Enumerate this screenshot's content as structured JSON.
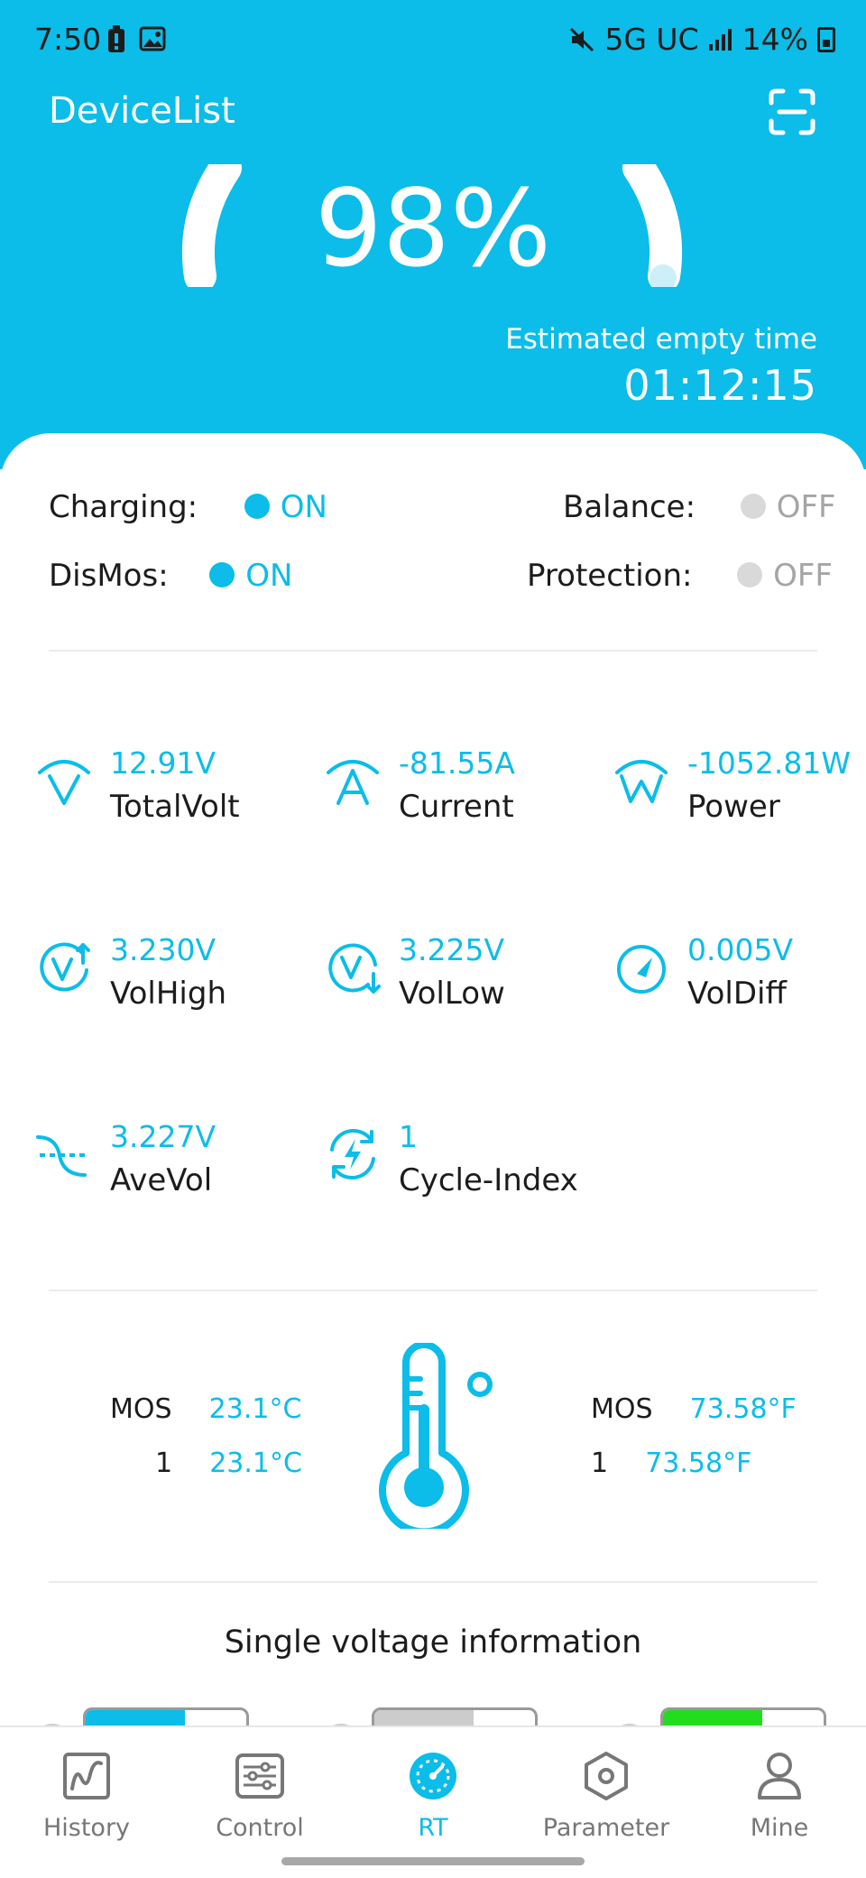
{
  "status_bar": {
    "time": "7:50",
    "network": "5G UC",
    "battery_percent": "14%"
  },
  "header": {
    "title": "DeviceList",
    "soc": "98%",
    "empty_time_label": "Estimated empty time",
    "empty_time_value": "01:12:15",
    "soc_fraction": 0.98
  },
  "states": {
    "charging": {
      "label": "Charging:",
      "value": "ON"
    },
    "dismos": {
      "label": "DisMos:",
      "value": "ON"
    },
    "balance": {
      "label": "Balance:",
      "value": "OFF"
    },
    "protection": {
      "label": "Protection:",
      "value": "OFF"
    }
  },
  "metrics": [
    {
      "value": "12.91V",
      "name": "TotalVolt",
      "icon": "volt-gauge-icon"
    },
    {
      "value": "-81.55A",
      "name": "Current",
      "icon": "amp-gauge-icon"
    },
    {
      "value": "-1052.81W",
      "name": "Power",
      "icon": "watt-gauge-icon"
    },
    {
      "value": "3.230V",
      "name": "VolHigh",
      "icon": "volt-up-icon"
    },
    {
      "value": "3.225V",
      "name": "VolLow",
      "icon": "volt-down-icon"
    },
    {
      "value": "0.005V",
      "name": "VolDiff",
      "icon": "gauge-icon"
    },
    {
      "value": "3.227V",
      "name": "AveVol",
      "icon": "average-wave-icon"
    },
    {
      "value": "1",
      "name": "Cycle-Index",
      "icon": "cycle-bolt-icon"
    }
  ],
  "temperatures": {
    "celsius": [
      {
        "label": "MOS",
        "value": "23.1°C"
      },
      {
        "label": "1",
        "value": "23.1°C"
      }
    ],
    "fahrenheit": [
      {
        "label": "MOS",
        "value": "73.58°F"
      },
      {
        "label": "1",
        "value": "73.58°F"
      }
    ]
  },
  "single_voltage": {
    "title": "Single voltage information",
    "cells": [
      {
        "fill_fraction": 0.62,
        "color": "#0bbde8"
      },
      {
        "fill_fraction": 0.62,
        "color": "#cccccc"
      },
      {
        "fill_fraction": 0.62,
        "color": "#22dd1e"
      }
    ]
  },
  "nav": [
    {
      "label": "History",
      "icon": "chart-line-icon",
      "active": false
    },
    {
      "label": "Control",
      "icon": "sliders-icon",
      "active": false
    },
    {
      "label": "RT",
      "icon": "dashboard-icon",
      "active": true
    },
    {
      "label": "Parameter",
      "icon": "hexagon-nut-icon",
      "active": false
    },
    {
      "label": "Mine",
      "icon": "user-icon",
      "active": false
    }
  ],
  "colors": {
    "accent": "#0bbde8",
    "off_dot": "#d9d9d9",
    "text": "#1c1c1c",
    "nav_inactive": "#777777"
  }
}
